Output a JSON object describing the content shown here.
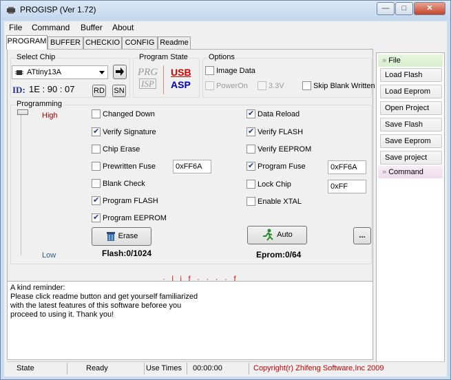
{
  "window": {
    "title": "PROGISP (Ver 1.72)",
    "minimize": "—",
    "maximize": "□",
    "close": "✕"
  },
  "menu": [
    "File",
    "Command",
    "Buffer",
    "About"
  ],
  "tabs": [
    "PROGRAM",
    "BUFFER",
    "CHECKIO",
    "CONFIG",
    "Readme"
  ],
  "select_chip": {
    "group_title": "Select Chip",
    "chip": "ATtiny13A",
    "id_label": "ID:",
    "id_value": "1E : 90 : 07",
    "rd": "RD",
    "sn": "SN"
  },
  "program_state": {
    "group_title": "Program State",
    "prg_top": "PRG",
    "prg_bottom": "ISP",
    "usb_top": "USB",
    "usb_bottom": "ASP"
  },
  "options": {
    "group_title": "Options",
    "image_data": "Image Data",
    "poweron": "PowerOn",
    "v33": "3.3V",
    "skip_blank": "Skip Blank Written"
  },
  "programming": {
    "group_title": "Programming",
    "high": "High",
    "low": "Low",
    "left_items": [
      {
        "label": "Changed Down",
        "checked": false
      },
      {
        "label": "Verify Signature",
        "checked": true
      },
      {
        "label": "Chip Erase",
        "checked": false
      },
      {
        "label": "Prewritten Fuse",
        "checked": false
      },
      {
        "label": "Blank Check",
        "checked": false
      },
      {
        "label": "Program FLASH",
        "checked": true
      },
      {
        "label": "Program EEPROM",
        "checked": true
      }
    ],
    "right_items": [
      {
        "label": "Data Reload",
        "checked": true
      },
      {
        "label": "Verify FLASH",
        "checked": true
      },
      {
        "label": "Verify EEPROM",
        "checked": false
      },
      {
        "label": "Program Fuse",
        "checked": true
      },
      {
        "label": "Lock Chip",
        "checked": false
      },
      {
        "label": "Enable XTAL",
        "checked": false
      }
    ],
    "prewritten_fuse_value": "0xFF6A",
    "program_fuse_value": "0xFF6A",
    "lock_value": "0xFF",
    "erase_button": "Erase",
    "auto_button": "Auto",
    "more_button": "...",
    "flash_count": "Flash:0/1024",
    "eprom_count": "Eprom:0/64"
  },
  "log_text": [
    "A kind reminder:",
    "Please click readme button and get yourself familiarized",
    "with the latest features of this software beforee you",
    "proceed to using it. Thank you!"
  ],
  "side_panel": {
    "file_header": "File",
    "buttons": [
      "Load Flash",
      "Load Eeprom",
      "Open Project",
      "Save Flash",
      "Save Eeprom",
      "Save project"
    ],
    "command_header": "Command"
  },
  "status": {
    "state_label": "State",
    "state_value": "Ready",
    "use_times_label": "Use Times",
    "use_times_value": "00:00:00",
    "copyright": "Copyright(r) Zhifeng Software,Inc 2009"
  },
  "colors": {
    "titlebar": "#c3d7ee",
    "high_low_text": "#a00000",
    "copyright_text": "#c00000",
    "usb_red": "#d00000",
    "usb_blue": "#0000c0",
    "id_blue": "#1e2f9a"
  }
}
